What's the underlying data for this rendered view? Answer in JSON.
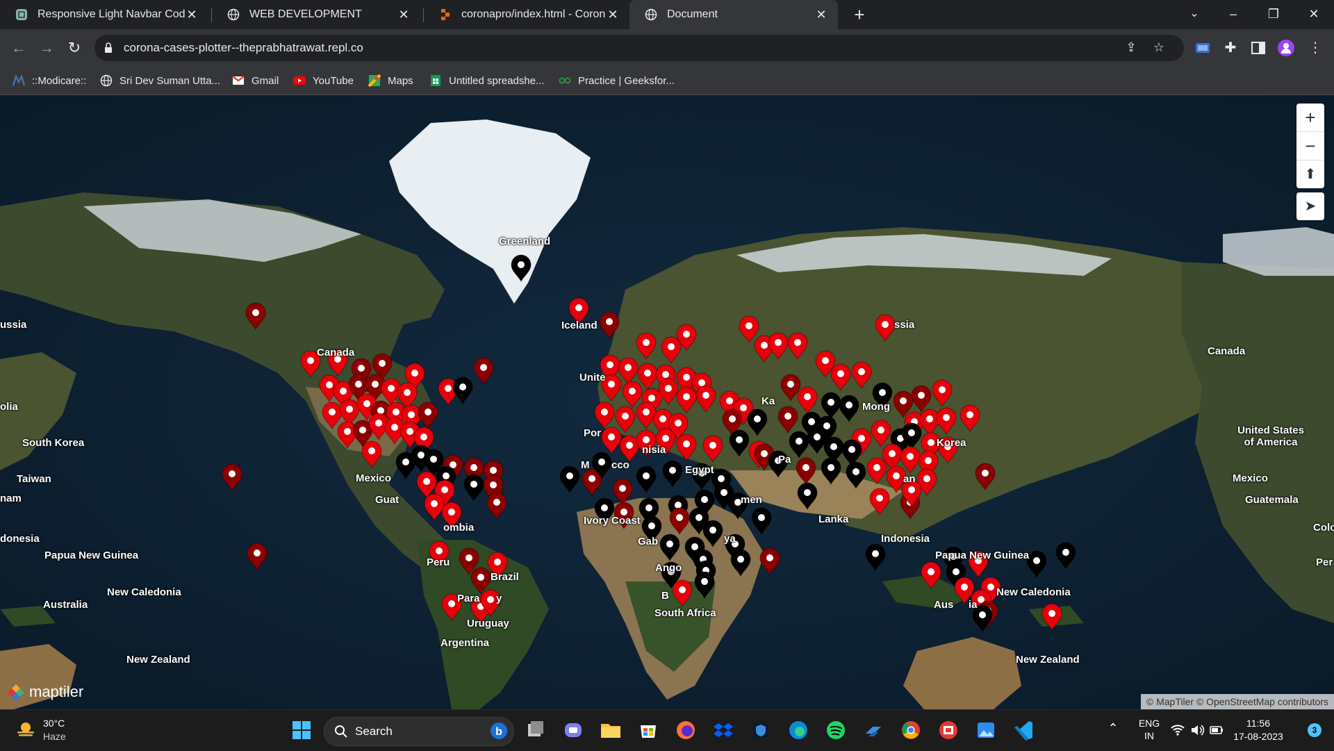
{
  "tabs": [
    {
      "label": "Responsive Light Navbar Code",
      "icon": "codepen-icon"
    },
    {
      "label": "WEB DEVELOPMENT",
      "icon": "globe-icon"
    },
    {
      "label": "coronapro/index.html - Corona C",
      "icon": "replit-icon"
    },
    {
      "label": "Document",
      "icon": "globe-icon"
    }
  ],
  "address": {
    "url": "corona-cases-plotter--theprabhatrawat.repl.co"
  },
  "bookmarks": [
    {
      "label": "::Modicare::",
      "icon": "modicare-icon"
    },
    {
      "label": "Sri Dev Suman Utta...",
      "icon": "globe-icon"
    },
    {
      "label": "Gmail",
      "icon": "gmail-icon"
    },
    {
      "label": "YouTube",
      "icon": "youtube-icon"
    },
    {
      "label": "Maps",
      "icon": "maps-icon"
    },
    {
      "label": "Untitled spreadshe...",
      "icon": "sheets-icon"
    },
    {
      "label": "Practice | Geeksfor...",
      "icon": "geeksforgeeks-icon"
    }
  ],
  "map": {
    "labels": [
      "Greenland",
      "ussia",
      "Iceland",
      "Canada",
      "ssia",
      "Canada",
      "United States of America",
      "olia",
      "South Korea",
      "Taiwan",
      "nam",
      "Mexico",
      "Guat",
      "Mexico",
      "Guatemala",
      "Colo",
      "Per",
      "donesia",
      "Papua New Guinea",
      "New Caledonia",
      "Australia",
      "New Zealand",
      "Unite",
      "Por",
      "nisia",
      "M",
      "cco",
      "Egypt",
      "Ka",
      "Mong",
      "Korea",
      "an",
      "Pa",
      "Lanka",
      "Indonesia",
      "Papua New Guinea",
      "New Caledonia",
      "Aus",
      "ia",
      "New Zealand",
      "South Africa",
      "Ivory Coast",
      "Gab",
      "ya",
      "Ango",
      "B",
      "Brazil",
      "Para",
      "y",
      "Uruguay",
      "Argentina",
      "Peru",
      "ombia",
      "men"
    ],
    "attribution": "© MapTiler © OpenStreetMap contributors",
    "logo_text": "maptiler",
    "pin_colors": {
      "high": "#e8000b",
      "mid": "#8b0000",
      "low": "#000000"
    }
  },
  "taskbar": {
    "weather": {
      "temp": "30°C",
      "desc": "Haze"
    },
    "search_placeholder": "Search",
    "lang": "ENG",
    "region": "IN",
    "time": "11:56",
    "date": "17-08-2023",
    "notifications": "3"
  }
}
